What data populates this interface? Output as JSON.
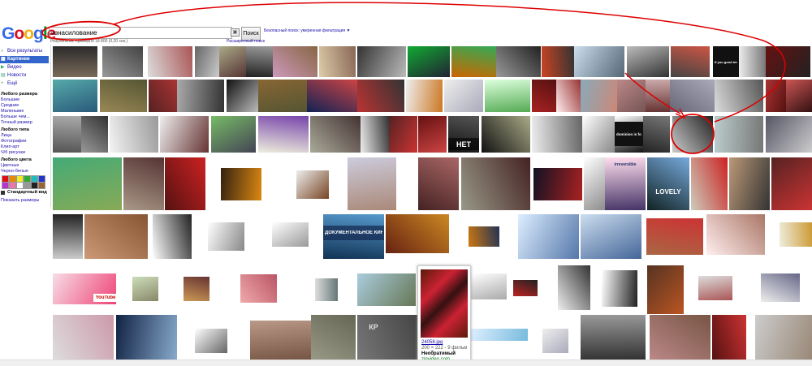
{
  "logo": "Google",
  "search": {
    "value": "изнасилование",
    "button": "Поиск"
  },
  "top_links": {
    "safe_search": "Безопасный поиск: умеренная фильтрация ▼",
    "advanced": "Расширенный поиск"
  },
  "stats": "Результатов: примерно 18 800 (0,20 сек.)",
  "sidebar": {
    "items": [
      {
        "label": "Все результаты",
        "icon": "search-icon"
      },
      {
        "label": "Картинки",
        "icon": "images-icon"
      },
      {
        "label": "Видео",
        "icon": "video-icon"
      },
      {
        "label": "Новости",
        "icon": "news-icon"
      },
      {
        "label": "Ещё",
        "icon": "more-icon"
      }
    ],
    "size_heading": "Любого размера",
    "size_options": [
      "Большие",
      "Средние",
      "Маленькие",
      "Больше чем...",
      "Точный размер"
    ],
    "type_heading": "Любого типа",
    "type_options": [
      "Лица",
      "Фотографии",
      "Клип-арт",
      "Ч/б рисунки"
    ],
    "color_heading": "Любого цвета",
    "color_options": [
      "Цветные",
      "Черно-белые"
    ],
    "swatches": [
      "#d11",
      "#e80",
      "#ee2",
      "#3a3",
      "#2bb",
      "#23c",
      "#b3c",
      "#e7a",
      "#fff",
      "#999",
      "#222",
      "#963"
    ],
    "standard_view": "Стандартный вид",
    "show_sizes": "Показать размеры"
  },
  "tile_texts": {
    "net": "НЕТ",
    "want_good": "If you good tender raped",
    "doc_kino": "ДОКУМЕНТАЛЬНОЕ КИНО",
    "lovely": "LOVELY",
    "inoperable": "irreversible",
    "youtube": "YouTube",
    "dominion": "dominion is for rape",
    "kr": "КР"
  },
  "hover": {
    "title": "24058.jpg",
    "dims": "200 × 222 - 9 фильм",
    "line2": "Необратимый",
    "domain": "zinvideo.com"
  }
}
